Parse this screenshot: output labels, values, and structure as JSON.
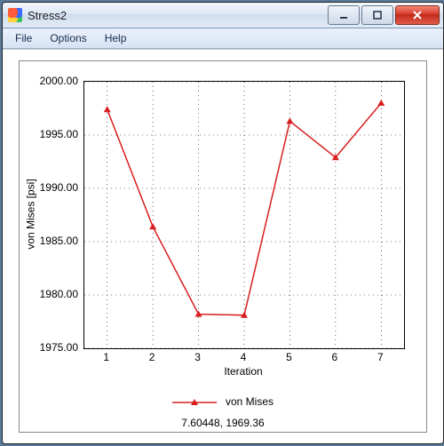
{
  "window": {
    "title": "Stress2"
  },
  "menu": {
    "file": "File",
    "options": "Options",
    "help": "Help"
  },
  "status": {
    "cursor": "7.60448, 1969.36"
  },
  "legend": {
    "series1": "von Mises"
  },
  "colors": {
    "series": "#d81e1e"
  },
  "chart_data": {
    "type": "line",
    "title": "",
    "xlabel": "Iteration",
    "ylabel": "von Mises [psi]",
    "xlim": [
      0.5,
      7.5
    ],
    "ylim": [
      1975,
      2000
    ],
    "yticks": [
      1975.0,
      1980.0,
      1985.0,
      1990.0,
      1995.0,
      2000.0
    ],
    "ytick_labels": [
      "1975.00",
      "1980.00",
      "1985.00",
      "1990.00",
      "1995.00",
      "2000.00"
    ],
    "xticks": [
      1,
      2,
      3,
      4,
      5,
      6,
      7
    ],
    "xtick_labels": [
      "1",
      "2",
      "3",
      "4",
      "5",
      "6",
      "7"
    ],
    "series": [
      {
        "name": "von Mises",
        "color": "#d81e1e",
        "x": [
          1,
          2,
          3,
          4,
          5,
          6,
          7
        ],
        "y": [
          1997.4,
          1986.4,
          1978.2,
          1978.1,
          1996.3,
          1992.9,
          1998.0
        ]
      }
    ]
  }
}
